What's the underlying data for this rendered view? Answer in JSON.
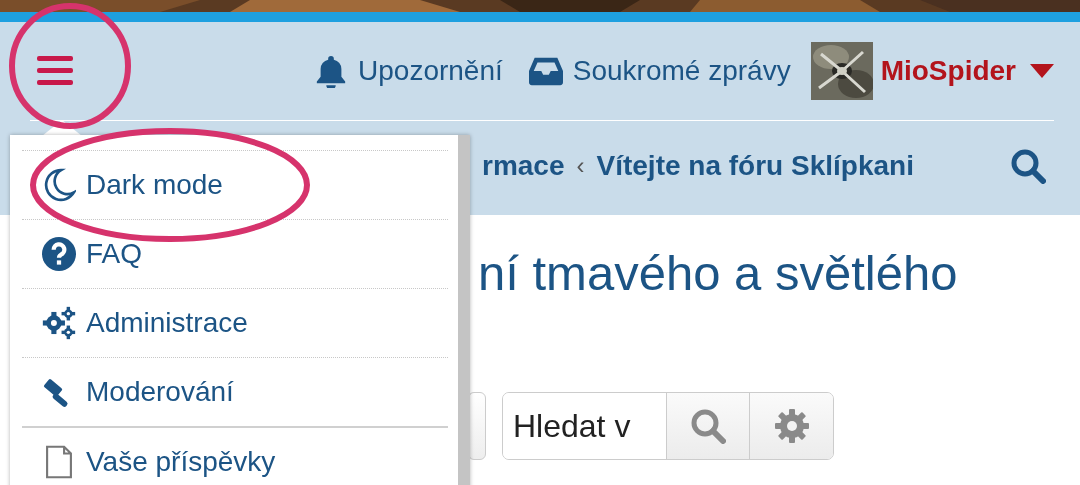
{
  "header": {
    "nav": [
      {
        "kind": "bell",
        "label": "Upozornění"
      },
      {
        "kind": "inbox",
        "label": "Soukromé zprávy"
      }
    ],
    "user": {
      "name": "MioSpider"
    }
  },
  "breadcrumb": {
    "items": [
      "rmace",
      "Vítejte na fóru Sklípkani"
    ],
    "separator": "‹"
  },
  "page_title": "ní tmavého a světlého",
  "search": {
    "value": "Hledat v"
  },
  "menu": {
    "items": [
      {
        "kind": "moon",
        "label": "Dark mode",
        "section_break": false
      },
      {
        "kind": "question",
        "label": "FAQ",
        "section_break": false
      },
      {
        "kind": "gears",
        "label": "Administrace",
        "section_break": false
      },
      {
        "kind": "gavel",
        "label": "Moderování",
        "section_break": false
      },
      {
        "kind": "file",
        "label": "Vaše příspěvky",
        "section_break": true
      }
    ]
  }
}
